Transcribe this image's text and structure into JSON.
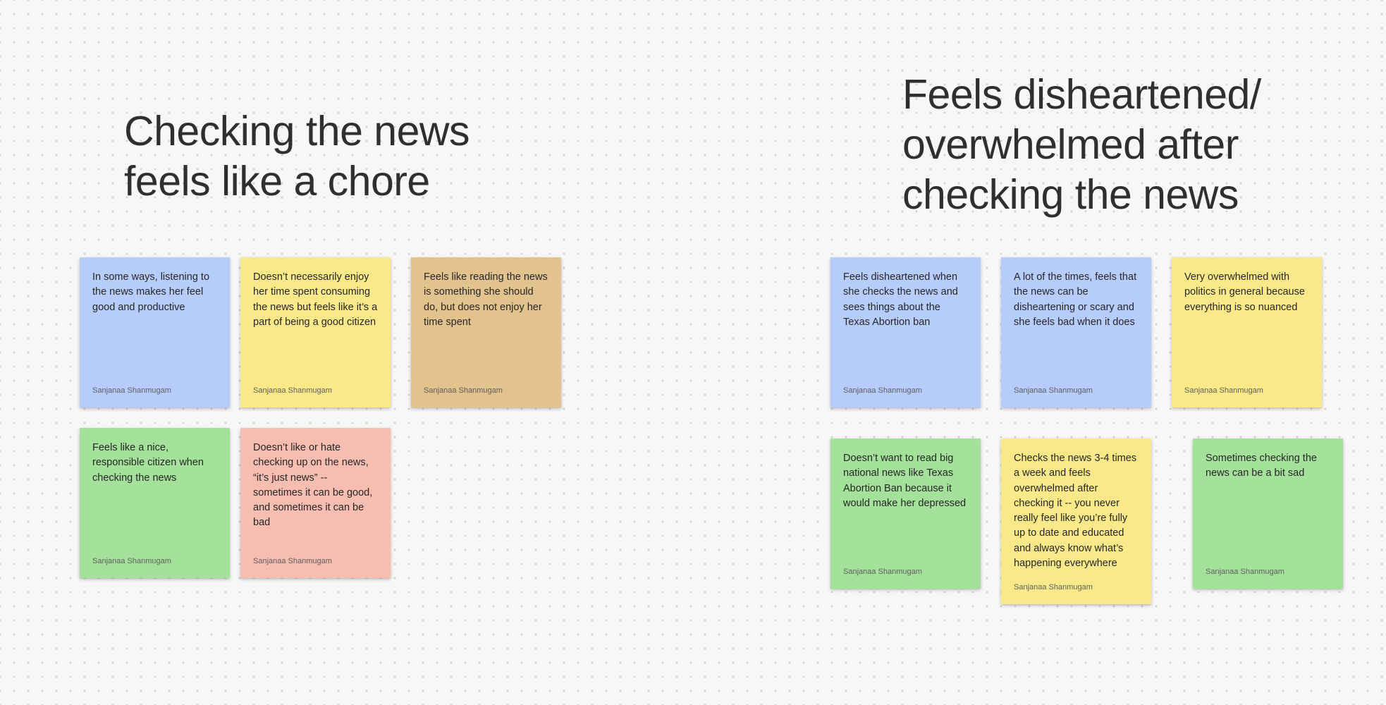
{
  "clusters": [
    {
      "heading_lines": [
        "Checking the news",
        "feels like a chore"
      ],
      "notes": [
        {
          "text": "In some ways, listening to the news makes her feel good and productive",
          "author": "Sanjanaa Shanmugam",
          "color": "#b6ccfb"
        },
        {
          "text": "Doesn’t necessarily enjoy her time spent consuming the news but feels like it’s a part of being a good citizen",
          "author": "Sanjanaa Shanmugam",
          "color": "#fae989"
        },
        {
          "text": "Feels like reading the news is something she should do, but does not enjoy her time spent",
          "author": "Sanjanaa Shanmugam",
          "color": "#e2c28d"
        },
        {
          "text": "Feels like a nice, responsible citizen when checking the news",
          "author": "Sanjanaa Shanmugam",
          "color": "#a4e19a"
        },
        {
          "text": "Doesn’t like or hate checking up on the news, “it’s just news” -- sometimes it can be good, and sometimes it can be bad",
          "author": "Sanjanaa Shanmugam",
          "color": "#f6bdb0"
        }
      ]
    },
    {
      "heading_lines": [
        "Feels disheartened/",
        "overwhelmed after",
        "checking the news"
      ],
      "notes": [
        {
          "text": "Feels disheartened when she checks the news and sees things about the Texas Abortion ban",
          "author": "Sanjanaa Shanmugam",
          "color": "#b6ccfb"
        },
        {
          "text": "A lot of the times, feels that the news can be disheartening or scary and she feels bad when it does",
          "author": "Sanjanaa Shanmugam",
          "color": "#b6ccfb"
        },
        {
          "text": "Very overwhelmed with politics in general because everything is so nuanced",
          "author": "Sanjanaa Shanmugam",
          "color": "#fae989"
        },
        {
          "text": "Doesn’t want to read big national news like Texas Abortion Ban because it would make her depressed",
          "author": "Sanjanaa Shanmugam",
          "color": "#a4e19a"
        },
        {
          "text": "Checks the news 3-4 times a week and feels overwhelmed after checking it -- you never really feel like you’re fully up to date and educated and always know what’s happening everywhere",
          "author": "Sanjanaa Shanmugam",
          "color": "#fae989"
        },
        {
          "text": "Sometimes checking the news can be a bit sad",
          "author": "Sanjanaa Shanmugam",
          "color": "#a4e19a"
        }
      ]
    }
  ]
}
